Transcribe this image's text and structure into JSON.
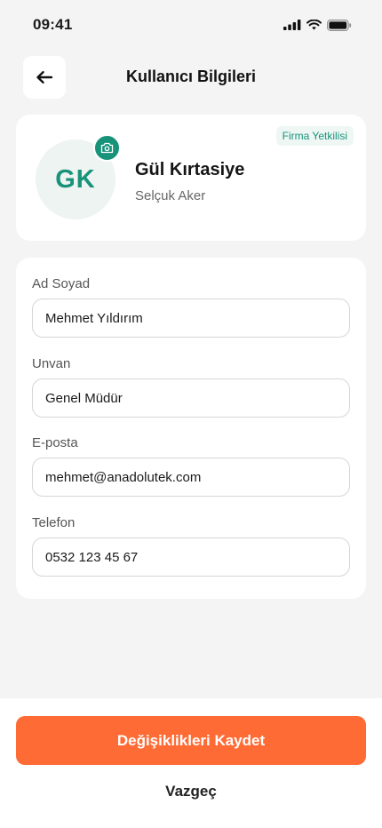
{
  "status_bar": {
    "time": "09:41",
    "icons": [
      "signal-icon",
      "wifi-icon",
      "battery-icon"
    ]
  },
  "header": {
    "back_icon": "arrow-left-icon",
    "title": "Kullanıcı Bilgileri"
  },
  "profile": {
    "initials": "GK",
    "camera_icon": "camera-icon",
    "badge": "Firma Yetkilisi",
    "company": "Gül Kırtasiye",
    "person": "Selçuk Aker"
  },
  "form": {
    "fields": [
      {
        "label": "Ad Soyad",
        "value": "Mehmet Yıldırım"
      },
      {
        "label": "Unvan",
        "value": "Genel Müdür"
      },
      {
        "label": "E-posta",
        "value": "mehmet@anadolutek.com"
      },
      {
        "label": "Telefon",
        "value": "0532 123 45 67"
      }
    ]
  },
  "actions": {
    "save_label": "Değişiklikleri Kaydet",
    "cancel_label": "Vazgeç"
  },
  "colors": {
    "accent": "#FF6B35",
    "brand_green": "#18937A",
    "background": "#F4F4F4"
  }
}
